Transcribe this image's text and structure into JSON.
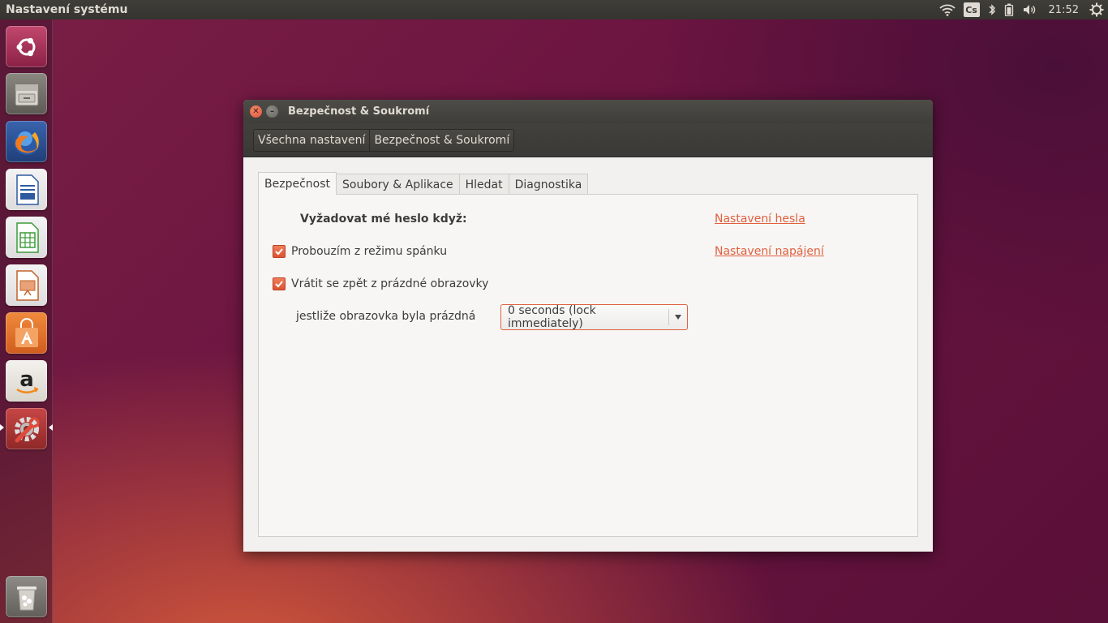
{
  "top_panel": {
    "app_title": "Nastavení systému",
    "keyboard_layout": "Cs",
    "clock": "21:52"
  },
  "launcher": {
    "items": [
      {
        "name": "dash-home",
        "color": "#9e2a4d"
      },
      {
        "name": "files",
        "color": "#6e6b66"
      },
      {
        "name": "firefox",
        "color": "#2b4d8a"
      },
      {
        "name": "libreoffice-writer",
        "color": "#3f5f99"
      },
      {
        "name": "libreoffice-calc",
        "color": "#3d8a3a"
      },
      {
        "name": "libreoffice-impress",
        "color": "#b5572a"
      },
      {
        "name": "ubuntu-software-center",
        "color": "#d86a2a"
      },
      {
        "name": "amazon",
        "color": "#eae6df"
      },
      {
        "name": "system-settings",
        "color": "#a83a3a"
      },
      {
        "name": "trash",
        "color": "#7d7a76"
      }
    ]
  },
  "window": {
    "title": "Bezpečnost & Soukromí",
    "breadcrumbs": [
      "Všechna nastavení",
      "Bezpečnost & Soukromí"
    ],
    "tabs": [
      "Bezpečnost",
      "Soubory & Aplikace",
      "Hledat",
      "Diagnostika"
    ],
    "active_tab": "Bezpečnost",
    "security": {
      "require_password_label": "Vyžadovat mé heslo když:",
      "password_settings_link": "Nastavení hesla",
      "power_settings_link": "Nastavení napájení",
      "wake_from_suspend": {
        "label": "Probouzím z režimu spánku",
        "checked": true
      },
      "return_from_blank": {
        "label": "Vrátit se zpět z prázdné obrazovky",
        "checked": true
      },
      "blank_delay_label": "jestliže obrazovka byla prázdná",
      "blank_delay_value": "0 seconds (lock immediately)"
    }
  },
  "colors": {
    "accent": "#e0603e",
    "panel_dark": "#3c3b37"
  }
}
